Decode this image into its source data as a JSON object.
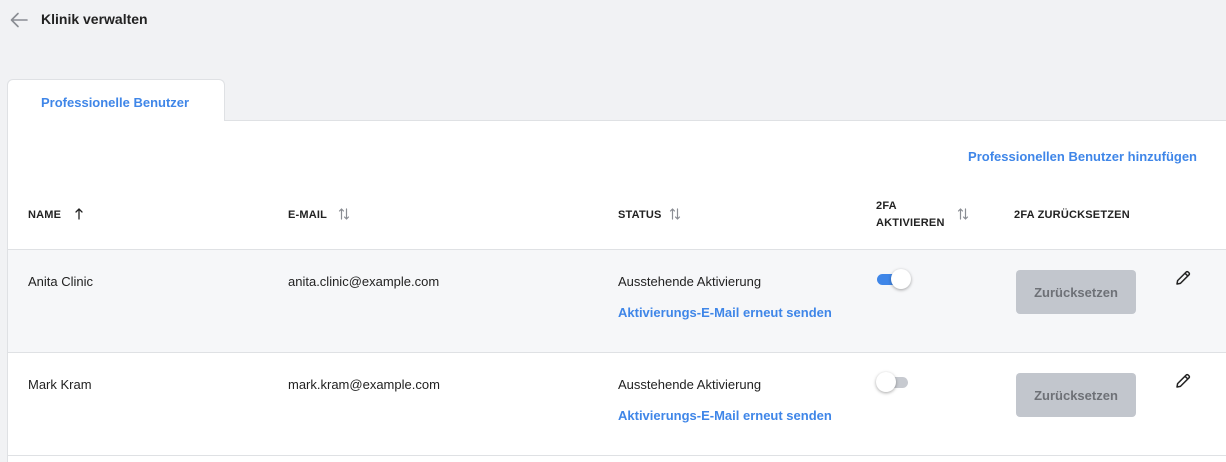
{
  "header": {
    "title": "Klinik verwalten",
    "back_icon": "arrow-left-icon"
  },
  "tabs": [
    {
      "label": "Professionelle Benutzer",
      "active": true
    }
  ],
  "actions": {
    "add_user": "Professionellen Benutzer hinzufügen"
  },
  "table": {
    "columns": {
      "name": "NAME",
      "email": "E-MAIL",
      "status": "STATUS",
      "twofa_enable_line1": "2FA",
      "twofa_enable_line2": "AKTIVIEREN",
      "twofa_reset": "2FA ZURÜCKSETZEN"
    },
    "rows": [
      {
        "name": "Anita Clinic",
        "email": "anita.clinic@example.com",
        "status": "Ausstehende Aktivierung",
        "resend": "Aktivierungs-E-Mail erneut senden",
        "twofa_enabled": true,
        "reset_label": "Zurücksetzen"
      },
      {
        "name": "Mark Kram",
        "email": "mark.kram@example.com",
        "status": "Ausstehende Aktivierung",
        "resend": "Aktivierungs-E-Mail erneut senden",
        "twofa_enabled": false,
        "reset_label": "Zurücksetzen"
      }
    ]
  },
  "colors": {
    "accent": "#3f86e8",
    "background": "#f1f2f4",
    "disabled_button": "#c2c6cd",
    "toggle_off": "#c7cad0"
  }
}
